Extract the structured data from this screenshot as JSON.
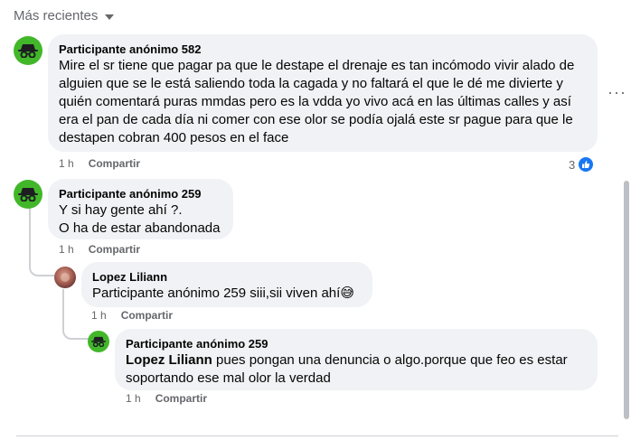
{
  "sort": {
    "label": "Más recientes"
  },
  "comments": [
    {
      "author": "Participante anónimo 582",
      "lines": [
        "Mire el sr tiene que pagar pa que le destape el drenaje es tan incómodo vivir alado de",
        "alguien que se le está saliendo toda la cagada y no faltará el que le dé me divierte y",
        "quién comentará puras mmdas pero es la vdda yo vivo acá en las últimas calles y así",
        "era el pan de cada día ni comer con ese olor se podía ojalá este sr pague para que le",
        "destapen cobran 400 pesos en el face"
      ],
      "time": "1 h",
      "reply": "Compartir",
      "reactions": "3",
      "avatar_icon": "anonymous-icon"
    },
    {
      "author": "Participante anónimo 259",
      "lines": [
        "Y si hay gente ahí ?.",
        "O ha de estar abandonada"
      ],
      "time": "1 h",
      "reply": "Compartir",
      "avatar_icon": "anonymous-icon"
    },
    {
      "author": "Lopez Liliann",
      "text": "Participante anónimo 259 siii,sii viven ahí😅",
      "time": "1 h",
      "reply": "Compartir",
      "avatar_icon": "profile-photo"
    },
    {
      "author": "Participante anónimo 259",
      "mention": "Lopez Liliann",
      "line1_rest": " pues pongan una denuncia o algo.porque que feo es estar",
      "line2": "soportando ese mal olor la verdad",
      "time": "1 h",
      "reply": "Compartir",
      "avatar_icon": "anonymous-icon"
    }
  ],
  "more_options": "···",
  "colors": {
    "accent": "#1877f2",
    "anon_avatar": "#42b72a",
    "bubble": "#f0f2f5",
    "muted": "#65676b"
  }
}
